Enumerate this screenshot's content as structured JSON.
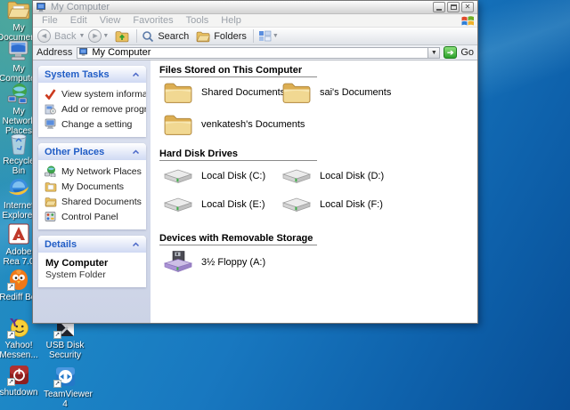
{
  "window": {
    "title": "My Computer",
    "menu_items": [
      "File",
      "Edit",
      "View",
      "Favorites",
      "Tools",
      "Help"
    ],
    "toolbar": {
      "back_label": "Back",
      "search_label": "Search",
      "folders_label": "Folders"
    },
    "address_bar": {
      "label": "Address",
      "value": "My Computer",
      "go_label": "Go"
    }
  },
  "sidebar": {
    "system_tasks": {
      "title": "System Tasks",
      "items": [
        {
          "label": "View system information"
        },
        {
          "label": "Add or remove programs"
        },
        {
          "label": "Change a setting"
        }
      ]
    },
    "other_places": {
      "title": "Other Places",
      "items": [
        {
          "label": "My Network Places"
        },
        {
          "label": "My Documents"
        },
        {
          "label": "Shared Documents"
        },
        {
          "label": "Control Panel"
        }
      ]
    },
    "details": {
      "title": "Details",
      "name": "My Computer",
      "description": "System Folder"
    }
  },
  "content": {
    "sections": [
      {
        "title": "Files Stored on This Computer",
        "items": [
          {
            "label": "Shared Documents"
          },
          {
            "label": "sai's Documents"
          },
          {
            "label": "venkatesh's Documents"
          }
        ]
      },
      {
        "title": "Hard Disk Drives",
        "items": [
          {
            "label": "Local Disk (C:)"
          },
          {
            "label": "Local Disk (D:)"
          },
          {
            "label": "Local Disk (E:)"
          },
          {
            "label": "Local Disk (F:)"
          }
        ]
      },
      {
        "title": "Devices with Removable Storage",
        "items": [
          {
            "label": "3½ Floppy (A:)"
          }
        ]
      }
    ]
  },
  "desktop": {
    "icons": [
      {
        "label": "My Documents"
      },
      {
        "label": "My Computer"
      },
      {
        "label": "My Network Places"
      },
      {
        "label": "Recycle Bin"
      },
      {
        "label": "Internet Explorer"
      },
      {
        "label": "Adobe Rea 7.0"
      },
      {
        "label": "Rediff Bol"
      },
      {
        "label": "Yahoo! Messen..."
      },
      {
        "label": "USB Disk Security"
      },
      {
        "label": "shutdown"
      },
      {
        "label": "TeamViewer 4"
      }
    ]
  },
  "colors": {
    "accent_blue": "#215dc6",
    "go_green": "#2ba12b",
    "desktop_teal": "#4fa79b",
    "desktop_blue": "#1277c0"
  }
}
